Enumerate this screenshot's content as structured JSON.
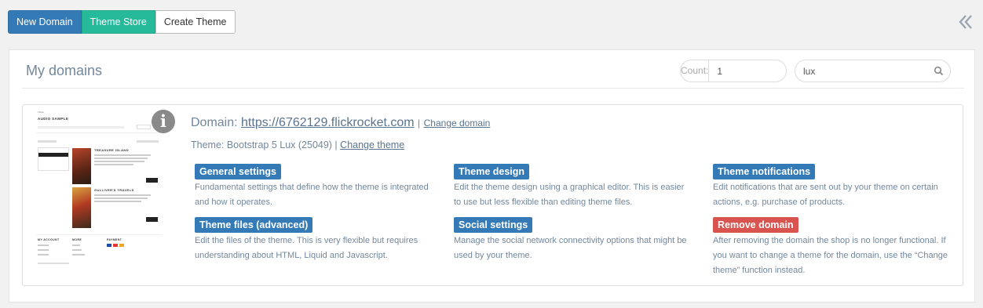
{
  "toolbar": {
    "new_domain": "New Domain",
    "theme_store": "Theme Store",
    "create_theme": "Create Theme"
  },
  "collapse_icon": "double-chevron-left-icon",
  "panel": {
    "title": "My domains",
    "count_label": "Count:",
    "count_value": "1",
    "search_value": "lux",
    "search_icon": "search-icon"
  },
  "domain": {
    "domain_label": "Domain:",
    "url": "https://6762129.flickrocket.com",
    "separator": "|",
    "change_domain": "Change domain",
    "theme_text": "Theme: Bootstrap 5 Lux (25049) |",
    "change_theme": "Change theme",
    "info_icon": "info-icon",
    "preview": {
      "brand_small": "Fliéke",
      "brand": "AUDIO SAMPLE",
      "product1_title": "TREASURE ISLAND",
      "product2_title": "GULLIVER'S TRAVELS",
      "footer_col1": "MY ACCOUNT",
      "footer_col2": "MORE",
      "footer_col3": "PAYMENT"
    },
    "actions": [
      {
        "label": "General settings",
        "desc": "Fundamental settings that define how the theme is integrated and how it operates.",
        "color": "#337ab7"
      },
      {
        "label": "Theme design",
        "desc": "Edit the theme design using a graphical editor. This is easier to use but less flexible than editing theme files.",
        "color": "#337ab7"
      },
      {
        "label": "Theme notifications",
        "desc": "Edit notifications that are sent out by your theme on certain actions, e.g. purchase of products.",
        "color": "#337ab7"
      },
      {
        "label": "Theme files (advanced)",
        "desc": "Edit the files of the theme. This is very flexible but requires understanding about HTML, Liquid and Javascript.",
        "color": "#337ab7"
      },
      {
        "label": "Social settings",
        "desc": "Manage the social network connectivity options that might be used by your theme.",
        "color": "#337ab7"
      },
      {
        "label": "Remove domain",
        "desc": "After removing the domain the shop is no longer functional. If you want to change a theme for the domain, use the “Change theme” function instead.",
        "color": "#d9534f"
      }
    ]
  }
}
